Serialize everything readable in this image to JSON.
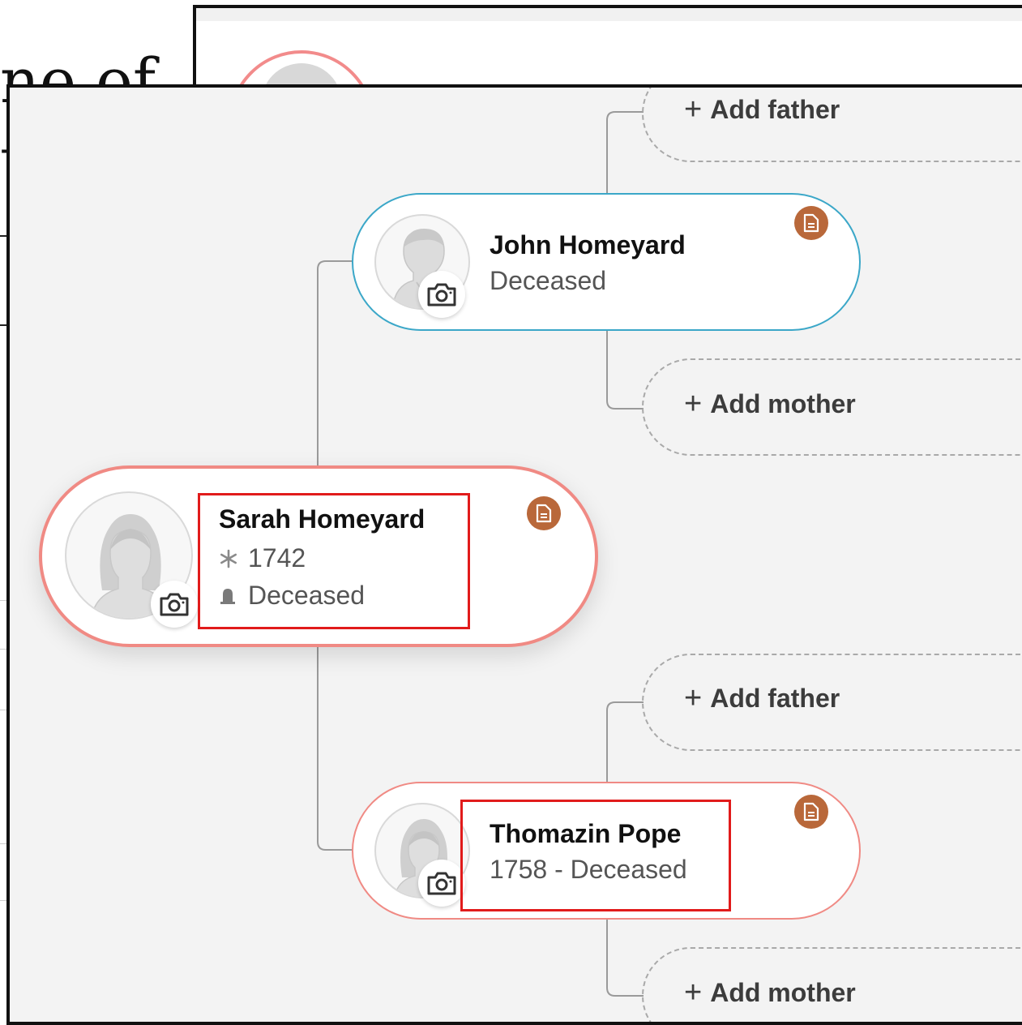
{
  "background_page": {
    "title_fragment": "ne of",
    "title_fragment_2": "t"
  },
  "tree": {
    "focus_person": {
      "name": "Sarah Homeyard",
      "birth": "1742",
      "death": "Deceased",
      "birth_icon": "asterisk-icon",
      "death_icon": "gravestone-icon",
      "gender": "female"
    },
    "father": {
      "name": "John Homeyard",
      "status": "Deceased",
      "gender": "male"
    },
    "mother": {
      "name": "Thomazin Pope",
      "status": "1758 - Deceased",
      "gender": "female"
    },
    "add_buttons": {
      "add_father_top": "Add father",
      "add_mother_top": "Add mother",
      "add_father_bottom": "Add father",
      "add_mother_bottom": "Add mother"
    },
    "colors": {
      "male_border": "#3ba7c8",
      "female_border": "#f08a84",
      "document_badge": "#b9683a",
      "highlight": "#e11b1b"
    }
  }
}
